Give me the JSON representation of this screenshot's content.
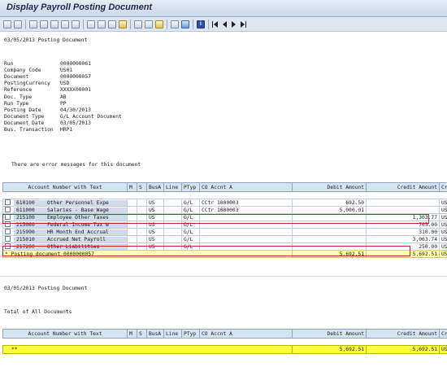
{
  "window": {
    "title": "Display Payroll Posting Document"
  },
  "toolbar": {
    "icons": [
      "details-icon",
      "select-icon",
      "first-icon",
      "sort-asc-icon",
      "sort-desc-icon",
      "filter-icon",
      "sum-icon",
      "subtotal-icon",
      "print-icon",
      "export-icon",
      "mail-icon",
      "layout-icon",
      "change-layout-icon",
      "save-layout-icon",
      "grid-icon",
      "graphic-icon",
      "info-icon"
    ],
    "nav": [
      "first-page",
      "prev-page",
      "next-page",
      "last-page"
    ]
  },
  "header_line": "03/05/2013 Posting Document",
  "doc_fields": [
    {
      "label": "Run",
      "value": "0000000061"
    },
    {
      "label": "Company Code",
      "value": "US01"
    },
    {
      "label": "Document",
      "value": "0000000057"
    },
    {
      "label": "PostingCurrency",
      "value": "USD"
    },
    {
      "label": "Reference",
      "value": "XXXXX00001"
    },
    {
      "label": "Doc. Type",
      "value": "AB"
    },
    {
      "label": "Run Type",
      "value": "PP"
    },
    {
      "label": "Posting Date",
      "value": "04/30/2013"
    },
    {
      "label": "Document Type",
      "value": "G/L Account Document"
    },
    {
      "label": "Document Date",
      "value": "03/05/2013"
    },
    {
      "label": "Bus. Transaction",
      "value": "HRP1"
    }
  ],
  "error_message": "There are error messages for this document",
  "columns": {
    "account": "Account Number with Text",
    "m": "M",
    "s": "S",
    "busa": "BusA",
    "line": "Line",
    "ptyp": "PTyp",
    "co": "CO Accnt A",
    "debit": "Debit Amount",
    "credit": "Credit Amount",
    "crcy": "Crcy"
  },
  "rows": [
    {
      "acct": "610100",
      "text": "Other Personnel Expe",
      "busa": "US",
      "ptyp": "G/L",
      "co": "CCtr 1000003",
      "debit": "692.50",
      "credit": "",
      "crcy": "USD"
    },
    {
      "acct": "611000",
      "text": "Salaries - Base Wage",
      "busa": "US",
      "ptyp": "G/L",
      "co": "CCtr 1000003",
      "debit": "5,000.01",
      "credit": "",
      "crcy": "USD"
    },
    {
      "acct": "215100",
      "text": "Employee Other Taxes",
      "busa": "US",
      "ptyp": "G/L",
      "co": "",
      "debit": "",
      "credit": "1,303.77",
      "crcy": "USD"
    },
    {
      "acct": "215060",
      "text": "Federal Income Tax W",
      "busa": "US",
      "ptyp": "G/L",
      "co": "",
      "debit": "",
      "credit": "765.00",
      "crcy": "USD"
    },
    {
      "acct": "215990",
      "text": "HR Month End Accrual",
      "busa": "US",
      "ptyp": "G/L",
      "co": "",
      "debit": "",
      "credit": "310.00",
      "crcy": "USD"
    },
    {
      "acct": "215010",
      "text": "Accrued Net Payroll",
      "busa": "US",
      "ptyp": "G/L",
      "co": "",
      "debit": "",
      "credit": "3,063.74",
      "crcy": "USD"
    },
    {
      "acct": "217200",
      "text": "Other Liabilities",
      "busa": "US",
      "ptyp": "G/L",
      "co": "",
      "debit": "",
      "credit": "250.00",
      "crcy": "USD"
    }
  ],
  "subtotal": {
    "label": "* Posting document 0000000057",
    "debit": "5,692.51",
    "credit": "5,692.51",
    "crcy": "USD"
  },
  "footer_line": "03/05/2013 Posting Document",
  "total_title": "Total of All Documents",
  "total": {
    "label": "**",
    "debit": "5,692.51",
    "credit": "5,692.51",
    "crcy": "USD"
  },
  "colors": {
    "highlight": "#c3242b",
    "subtotal_bg": "#ffffb0",
    "total_bg": "#ffff3c",
    "header_bg": "#d6e4f2"
  }
}
